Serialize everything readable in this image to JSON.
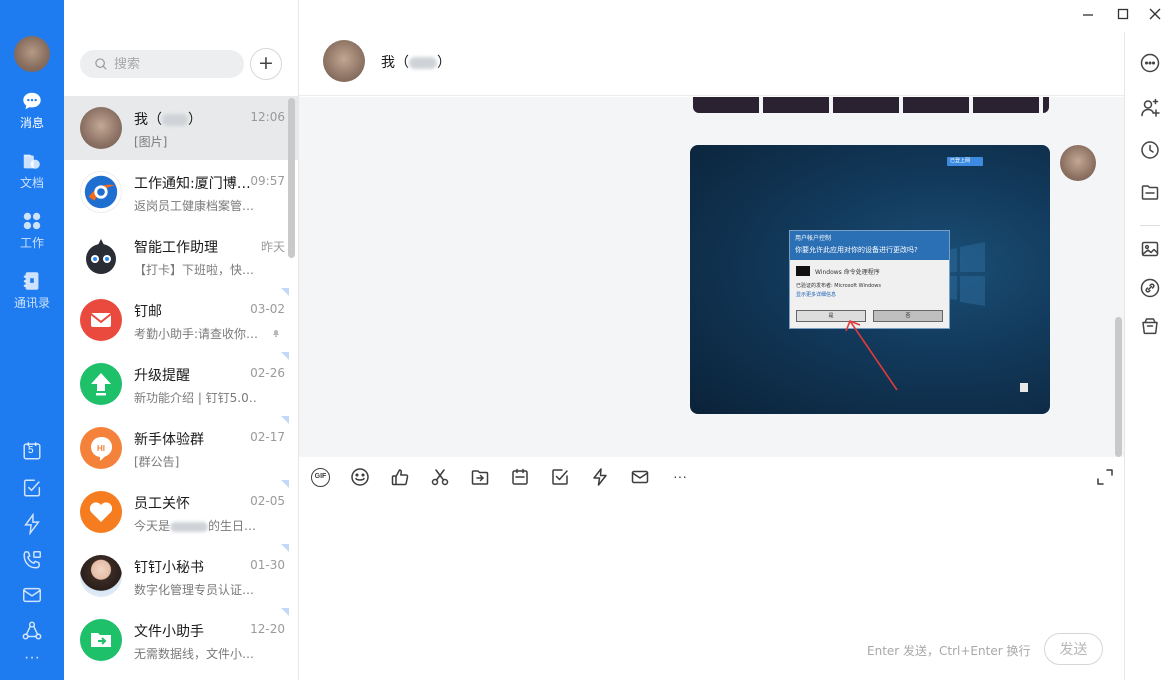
{
  "nav": {
    "items": [
      {
        "label": "消息",
        "icon": "message-icon"
      },
      {
        "label": "文档",
        "icon": "document-icon"
      },
      {
        "label": "工作",
        "icon": "workbench-icon"
      },
      {
        "label": "通讯录",
        "icon": "contacts-icon"
      }
    ],
    "bottom_icons": [
      "calendar-icon",
      "todo-icon",
      "ding-icon",
      "phone-icon",
      "mail-icon",
      "org-icon",
      "more-icon"
    ],
    "calendar_day": "5"
  },
  "search": {
    "placeholder": "搜索"
  },
  "add_label": "+",
  "conversations": [
    {
      "name": "我（",
      "name_suffix": "）",
      "time": "12:06",
      "preview": "[图片]"
    },
    {
      "name": "工作通知:厦门博…",
      "time": "09:57",
      "preview": "返岗员工健康档案管…"
    },
    {
      "name": "智能工作助理",
      "time": "昨天",
      "preview": "【打卡】下班啦，快…"
    },
    {
      "name": "钉邮",
      "time": "03-02",
      "preview": "考勤小助手:请查收你…"
    },
    {
      "name": "升级提醒",
      "time": "02-26",
      "preview": "新功能介绍 | 钉钉5.0…"
    },
    {
      "name": "新手体验群",
      "time": "02-17",
      "preview": "[群公告]"
    },
    {
      "name": "员工关怀",
      "time": "02-05",
      "preview": "今天是",
      "preview_suffix": "的生日…"
    },
    {
      "name": "钉钉小秘书",
      "time": "01-30",
      "preview": "数字化管理专员认证…"
    },
    {
      "name": "文件小助手",
      "time": "12-20",
      "preview": "无需数据线，文件小…"
    }
  ],
  "chat": {
    "title_prefix": "我（",
    "title_suffix": "）",
    "image": {
      "uac_title": "用户帐户控制",
      "uac_question": "你要允许此应用对你的设备进行更改吗?",
      "app_name": "Windows 命令处理程序",
      "publisher": "已验证的发布者: Microsoft Windows",
      "details_link": "显示更多详细信息",
      "yes": "是",
      "no": "否",
      "chip": "已登上网"
    },
    "toolbar": [
      "gif-icon",
      "emoji-icon",
      "thumbs-up-icon",
      "screenshot-icon",
      "forward-file-icon",
      "calendar-icon",
      "todo-icon",
      "ding-icon",
      "mail-icon",
      "more-icon"
    ],
    "gif_label": "GIF",
    "more_label": "···",
    "hint": "Enter 发送，Ctrl+Enter 换行",
    "send_label": "发送"
  },
  "right_rail": [
    "more-options-icon",
    "add-member-icon",
    "history-icon",
    "folder-icon",
    "image-icon",
    "link-icon",
    "archive-icon"
  ],
  "colors": {
    "nav_blue": "#1e7bf0",
    "accent_red": "#e9453b",
    "accent_green": "#1ec06a",
    "accent_orange": "#f57c1f"
  }
}
